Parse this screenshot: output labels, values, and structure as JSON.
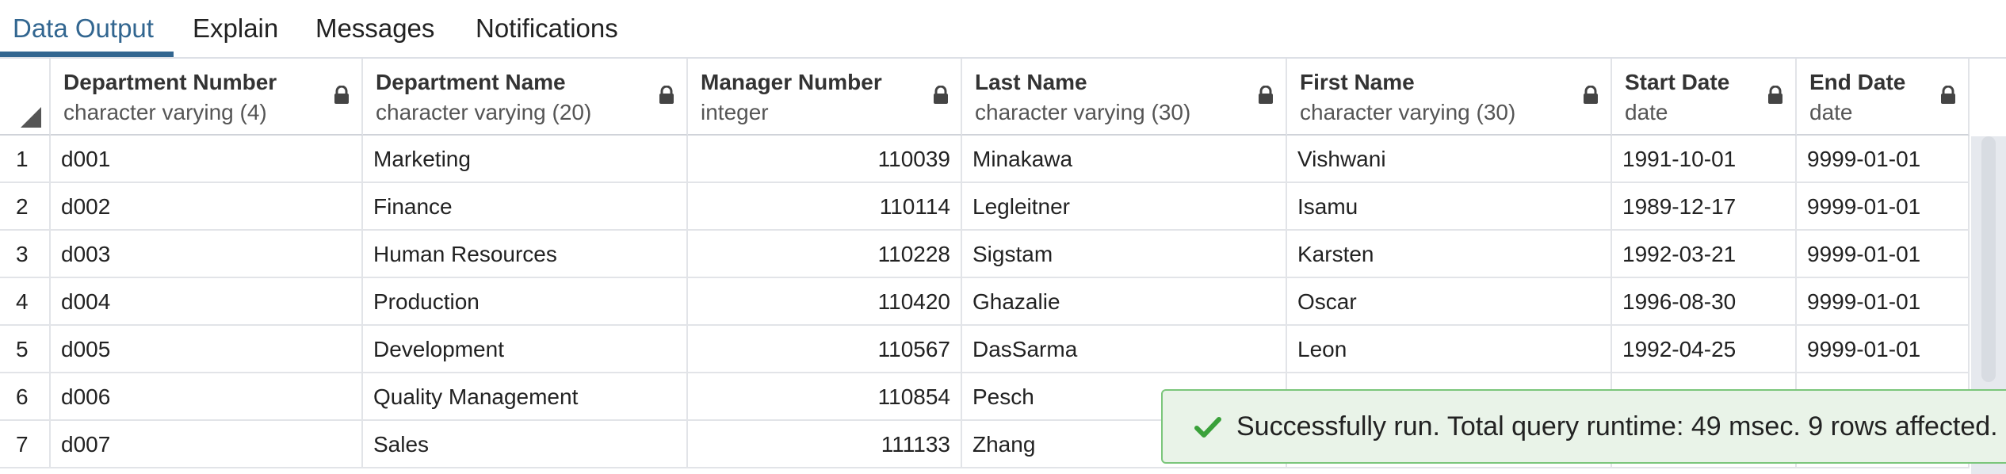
{
  "tabs": [
    {
      "label": "Data Output",
      "active": true
    },
    {
      "label": "Explain",
      "active": false
    },
    {
      "label": "Messages",
      "active": false
    },
    {
      "label": "Notifications",
      "active": false
    }
  ],
  "columns": [
    {
      "name": "Department Number",
      "type": "character varying (4)"
    },
    {
      "name": "Department Name",
      "type": "character varying (20)"
    },
    {
      "name": "Manager Number",
      "type": "integer"
    },
    {
      "name": "Last Name",
      "type": "character varying (30)"
    },
    {
      "name": "First Name",
      "type": "character varying (30)"
    },
    {
      "name": "Start Date",
      "type": "date"
    },
    {
      "name": "End Date",
      "type": "date"
    }
  ],
  "rows": [
    {
      "n": "1",
      "dept_no": "d001",
      "dept_name": "Marketing",
      "manager_no": "110039",
      "last_name": "Minakawa",
      "first_name": "Vishwani",
      "start_date": "1991-10-01",
      "end_date": "9999-01-01"
    },
    {
      "n": "2",
      "dept_no": "d002",
      "dept_name": "Finance",
      "manager_no": "110114",
      "last_name": "Legleitner",
      "first_name": "Isamu",
      "start_date": "1989-12-17",
      "end_date": "9999-01-01"
    },
    {
      "n": "3",
      "dept_no": "d003",
      "dept_name": "Human Resources",
      "manager_no": "110228",
      "last_name": "Sigstam",
      "first_name": "Karsten",
      "start_date": "1992-03-21",
      "end_date": "9999-01-01"
    },
    {
      "n": "4",
      "dept_no": "d004",
      "dept_name": "Production",
      "manager_no": "110420",
      "last_name": "Ghazalie",
      "first_name": "Oscar",
      "start_date": "1996-08-30",
      "end_date": "9999-01-01"
    },
    {
      "n": "5",
      "dept_no": "d005",
      "dept_name": "Development",
      "manager_no": "110567",
      "last_name": "DasSarma",
      "first_name": "Leon",
      "start_date": "1992-04-25",
      "end_date": "9999-01-01"
    },
    {
      "n": "6",
      "dept_no": "d006",
      "dept_name": "Quality Management",
      "manager_no": "110854",
      "last_name": "Pesch",
      "first_name": "",
      "start_date": "",
      "end_date": ""
    },
    {
      "n": "7",
      "dept_no": "d007",
      "dept_name": "Sales",
      "manager_no": "111133",
      "last_name": "Zhang",
      "first_name": "",
      "start_date": "",
      "end_date": ""
    }
  ],
  "toast": {
    "message": "Successfully run. Total query runtime: 49 msec. 9 rows affected.",
    "icon": "check-icon",
    "color": "#3aa13a"
  },
  "colors": {
    "accent": "#326690",
    "toast_border": "#7bc67b",
    "toast_bg": "#e9f3e8"
  }
}
